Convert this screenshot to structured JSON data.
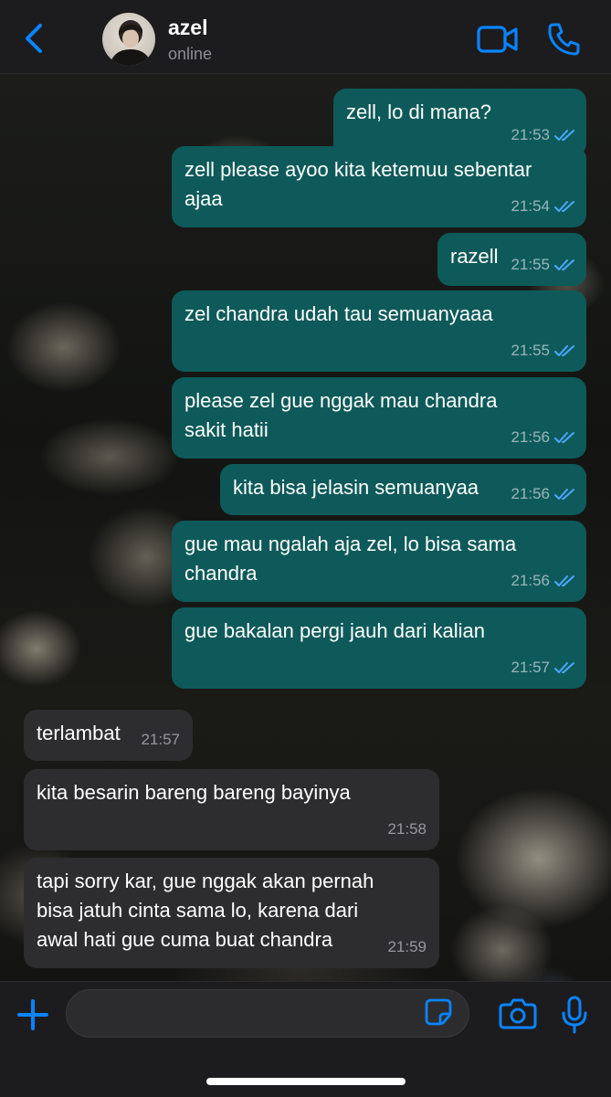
{
  "header": {
    "contact_name": "azel",
    "status": "online",
    "back_icon": "chevron-left-icon",
    "video_icon": "video-camera-icon",
    "call_icon": "phone-icon"
  },
  "colors": {
    "accent": "#0a84ff",
    "outgoing_bubble": "#0e5a5a",
    "incoming_bubble": "#2d2d2f",
    "read_ticks": "#4aa8ff"
  },
  "messages": [
    {
      "direction": "out",
      "text": "zell, lo di mana?",
      "time": "21:53",
      "status": "read"
    },
    {
      "direction": "out",
      "text": "zell please ayoo kita ketemuu sebentar\najaa",
      "time": "21:54",
      "status": "read"
    },
    {
      "direction": "out",
      "text": "razell",
      "time": "21:55",
      "status": "read"
    },
    {
      "direction": "out",
      "text": "zel chandra udah tau semuanyaaa",
      "time": "21:55",
      "status": "read"
    },
    {
      "direction": "out",
      "text": "please zel gue nggak mau chandra\nsakit hatii",
      "time": "21:56",
      "status": "read"
    },
    {
      "direction": "out",
      "text": "kita bisa jelasin semuanyaa",
      "time": "21:56",
      "status": "read"
    },
    {
      "direction": "out",
      "text": "gue mau ngalah aja zel, lo bisa sama\nchandra",
      "time": "21:56",
      "status": "read"
    },
    {
      "direction": "out",
      "text": "gue bakalan pergi jauh dari kalian",
      "time": "21:57",
      "status": "read"
    },
    {
      "direction": "in",
      "text": "terlambat",
      "time": "21:57"
    },
    {
      "direction": "in",
      "text": "kita besarin bareng bareng bayinya",
      "time": "21:58"
    },
    {
      "direction": "in",
      "text": "tapi sorry kar, gue nggak akan pernah\nbisa jatuh cinta sama lo, karena dari\nawal hati gue cuma buat chandra",
      "time": "21:59"
    }
  ],
  "input_bar": {
    "placeholder": "",
    "plus_icon": "plus-icon",
    "sticker_icon": "sticker-icon",
    "camera_icon": "camera-icon",
    "mic_icon": "microphone-icon"
  }
}
